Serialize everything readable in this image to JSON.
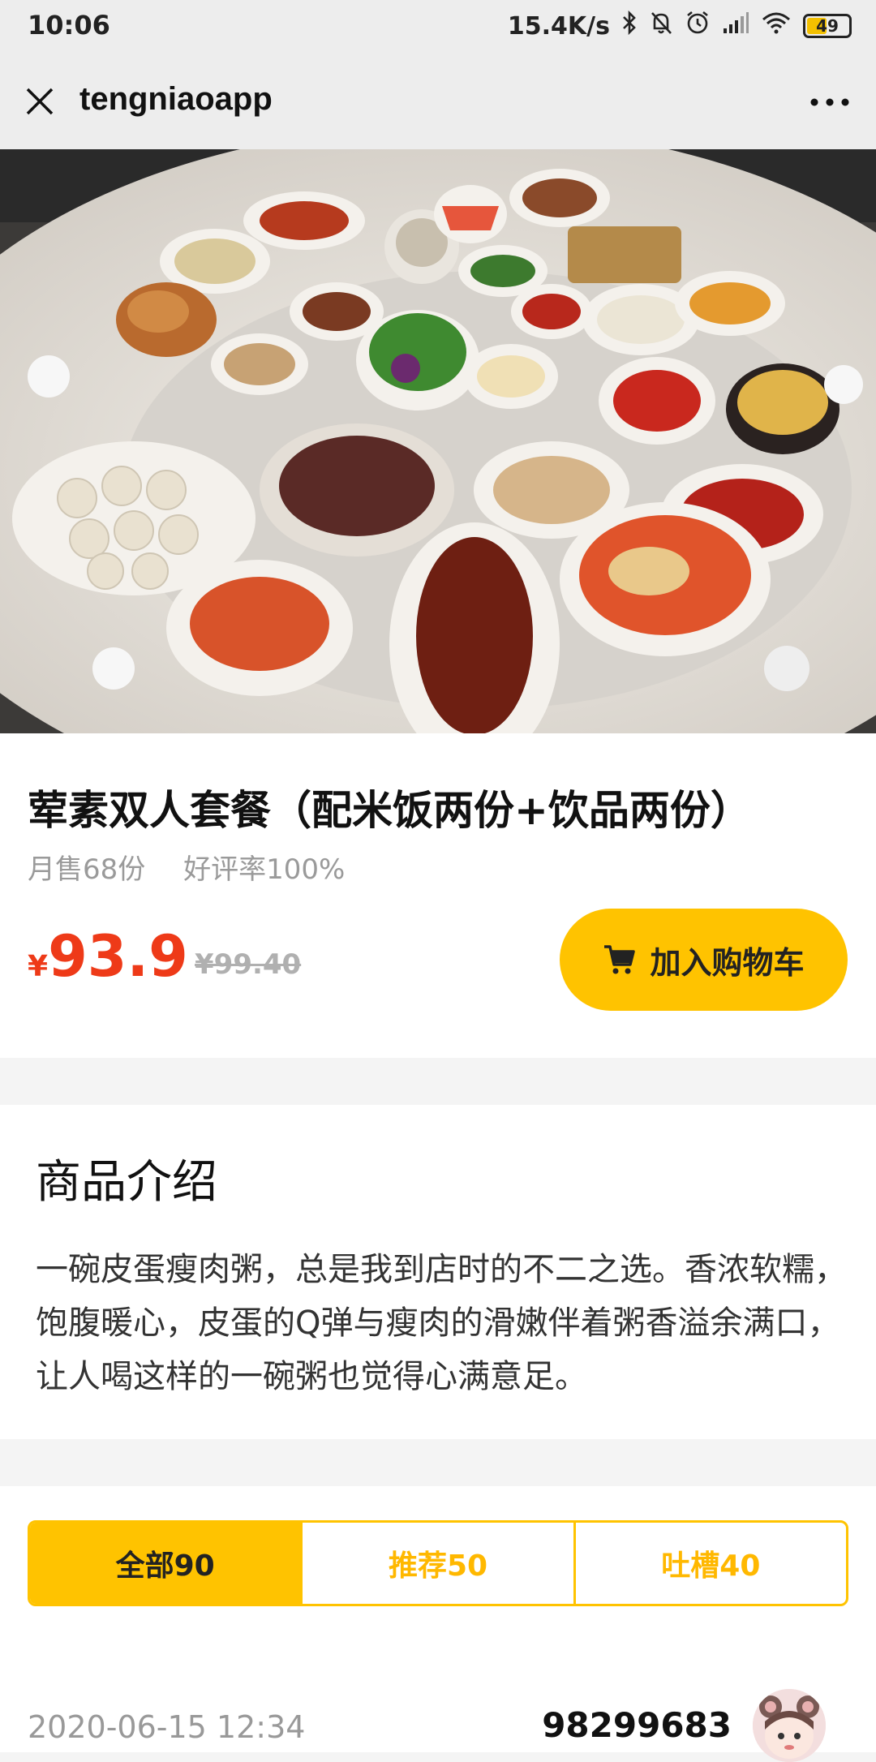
{
  "status_bar": {
    "time": "10:06",
    "network_speed": "15.4K/s",
    "battery": "49",
    "icons": [
      "bluetooth-icon",
      "bell-muted-icon",
      "alarm-icon",
      "signal-icon",
      "wifi-icon",
      "battery-icon"
    ]
  },
  "nav": {
    "title": "tengniaoapp",
    "close_icon": "close-icon",
    "more_icon": "more-dots-icon"
  },
  "product": {
    "title": "荤素双人套餐（配米饭两份+饮品两份）",
    "monthly_sales": "月售68份",
    "rating": "好评率100%",
    "currency_symbol": "¥",
    "price": "93.9",
    "original_price": "¥99.40",
    "add_to_cart": "加入购物车",
    "cart_icon": "cart-icon"
  },
  "intro": {
    "heading": "商品介绍",
    "text": "一碗皮蛋瘦肉粥，总是我到店时的不二之选。香浓软糯，饱腹暖心，皮蛋的Q弹与瘦肉的滑嫩伴着粥香溢余满口，让人喝这样的一碗粥也觉得心满意足。"
  },
  "reviews": {
    "tabs": [
      {
        "label": "全部90",
        "active": true
      },
      {
        "label": "推荐50",
        "active": false
      },
      {
        "label": "吐槽40",
        "active": false
      }
    ],
    "first_review": {
      "date": "2020-06-15 12:34",
      "user": "98299683"
    }
  },
  "colors": {
    "accent": "#ffc300",
    "price": "#ee3a18",
    "topbar": "#ededed"
  }
}
